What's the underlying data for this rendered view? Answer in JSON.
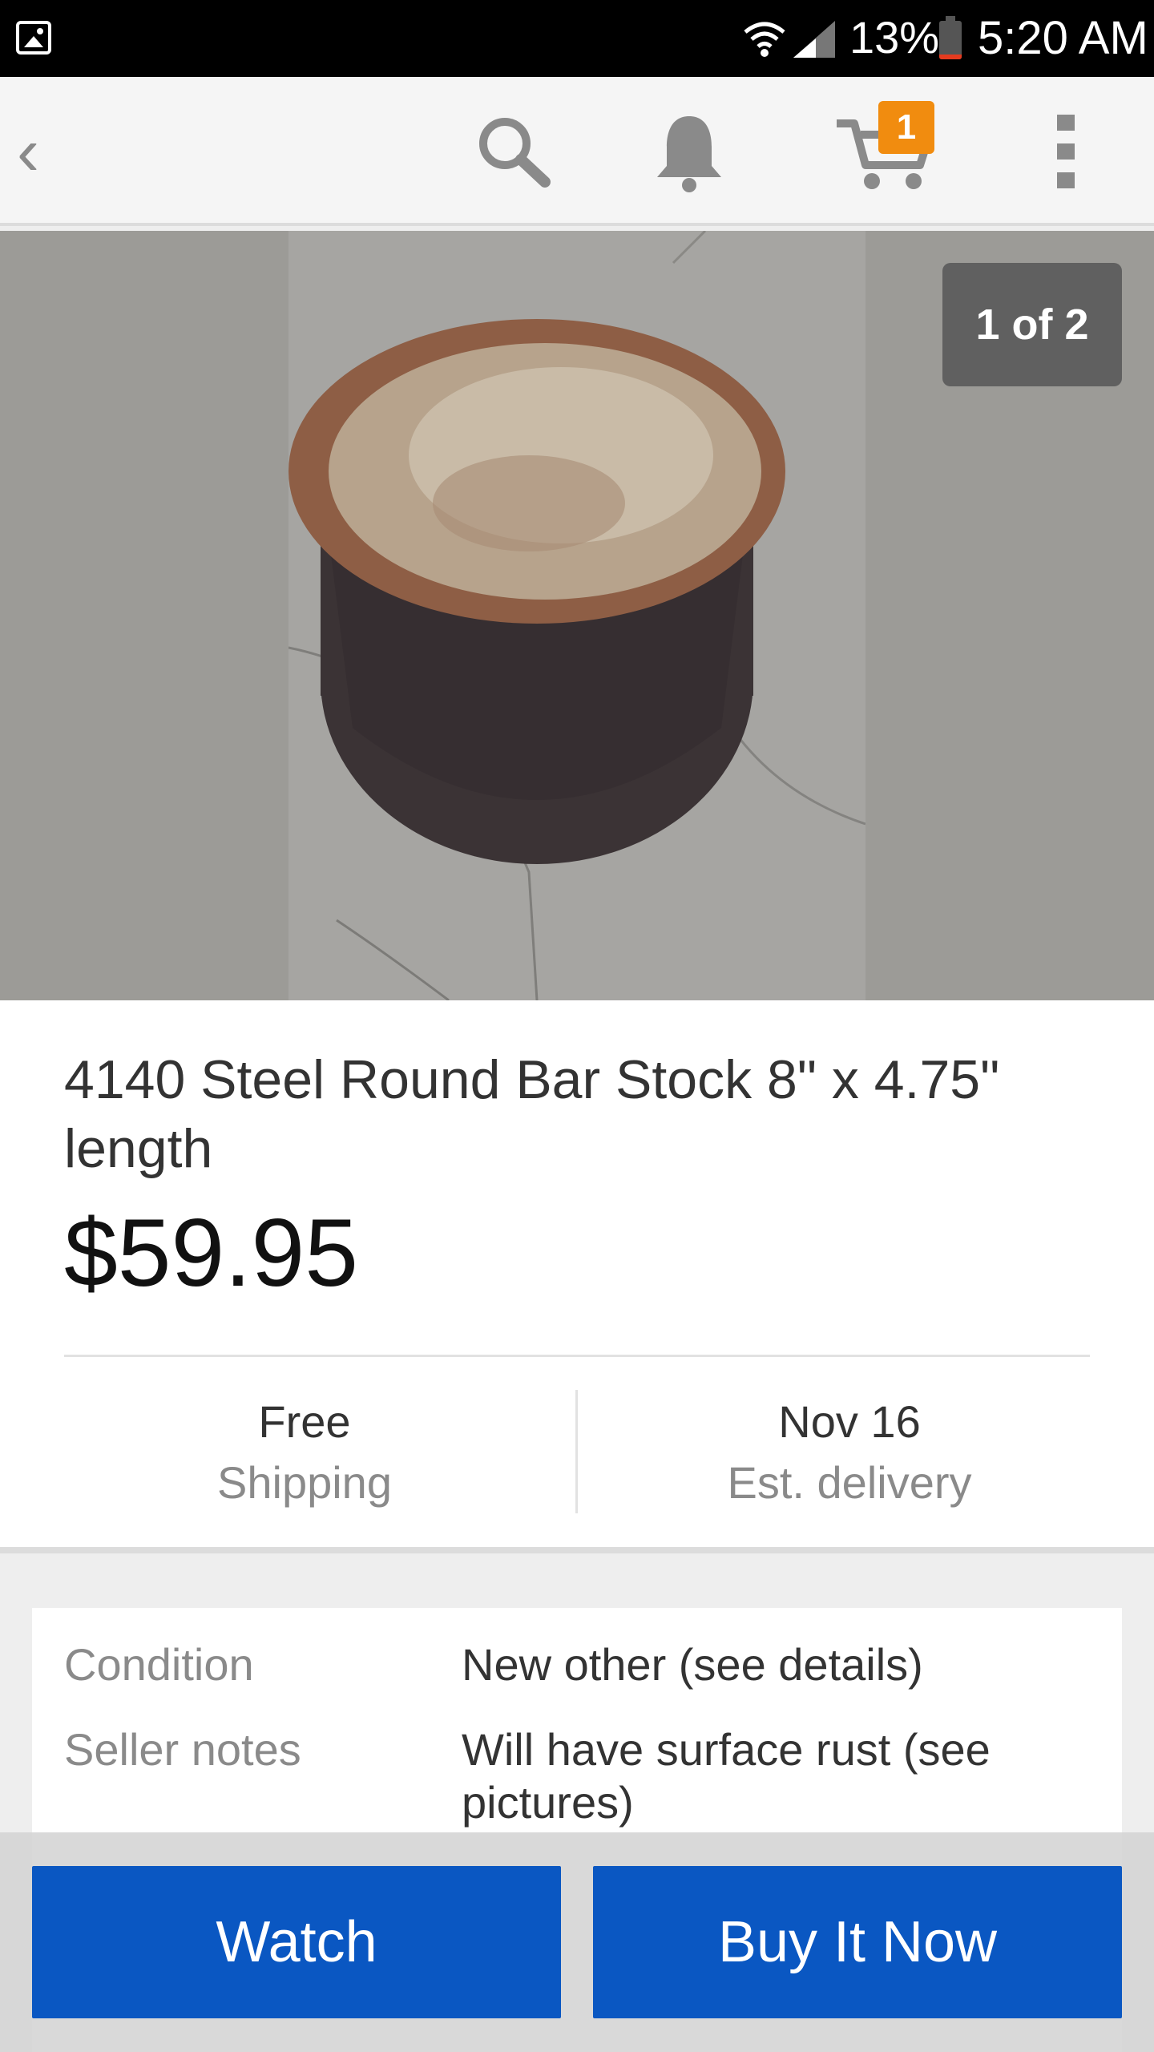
{
  "status_bar": {
    "battery_percent": "13%",
    "time": "5:20 AM",
    "battery_level": 0.13
  },
  "app_bar": {
    "back_icon": "chevron-left-icon",
    "search_icon": "search-icon",
    "notifications_icon": "bell-icon",
    "cart_icon": "cart-icon",
    "cart_count": "1",
    "more_icon": "more-vertical-icon"
  },
  "gallery": {
    "counter": "1 of 2"
  },
  "listing": {
    "title": "4140 Steel Round Bar Stock 8\" x 4.75\" length",
    "price": "$59.95",
    "shipping": {
      "value": "Free",
      "label": "Shipping"
    },
    "delivery": {
      "value": "Nov 16",
      "label": "Est. delivery"
    }
  },
  "details": {
    "rows": [
      {
        "key": "Condition",
        "value": "New other (see details)"
      },
      {
        "key": "Seller notes",
        "value": "Will have surface rust (see pictures)"
      }
    ]
  },
  "actions": {
    "watch": "Watch",
    "buy_it_now": "Buy It Now"
  },
  "colors": {
    "primary_button": "#0a57c2",
    "badge": "#f18c0f",
    "battery_low": "#e53b1f"
  }
}
